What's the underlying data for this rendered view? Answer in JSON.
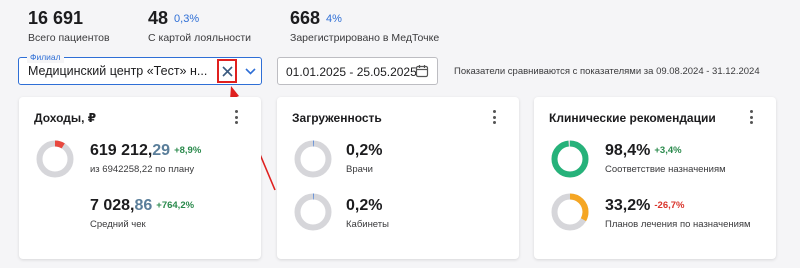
{
  "stats": [
    {
      "value": "16 691",
      "label": "Всего пациентов",
      "pct": ""
    },
    {
      "value": "48",
      "label": "С картой лояльности",
      "pct": "0,3%"
    },
    {
      "value": "668",
      "label": "Зарегистрировано в МедТочке",
      "pct": "4%"
    }
  ],
  "branch": {
    "legend": "Филиал",
    "value": "Медицинский центр «Тест» н..."
  },
  "date": {
    "value": "01.01.2025 - 25.05.2025"
  },
  "compare_note": "Показатели сравниваются с показателями за 09.08.2024 - 31.12.2024",
  "cards": {
    "income": {
      "title": "Доходы, ₽",
      "main_int": "619 212,",
      "main_frac": "29",
      "main_delta": "+8,9%",
      "main_sub": "из 6942258,22 по плану",
      "main_fill": 0.089,
      "avg_int": "7 028,",
      "avg_frac": "86",
      "avg_delta": "+764,2%",
      "avg_sub": "Средний чек"
    },
    "load": {
      "title": "Загруженность",
      "doctors_value": "0,2%",
      "doctors_label": "Врачи",
      "doctors_fill": 0.002,
      "rooms_value": "0,2%",
      "rooms_label": "Кабинеты",
      "rooms_fill": 0.002
    },
    "clinical": {
      "title": "Клинические рекомендации",
      "compliance_value": "98,4%",
      "compliance_delta": "+3,4%",
      "compliance_label": "Соответствие назначениям",
      "compliance_fill": 0.984,
      "plans_value": "33,2%",
      "plans_delta": "-26,7%",
      "plans_label": "Планов лечения по назначениям",
      "plans_fill": 0.332
    }
  },
  "colors": {
    "accent": "#2f6fd6",
    "ring_track": "#d6d6da",
    "income_ring": "#e8483f",
    "load_ring": "#2f6fd6",
    "compliance_ring": "#26b27a",
    "plans_ring": "#f5a623",
    "highlight": "#e0201f"
  }
}
